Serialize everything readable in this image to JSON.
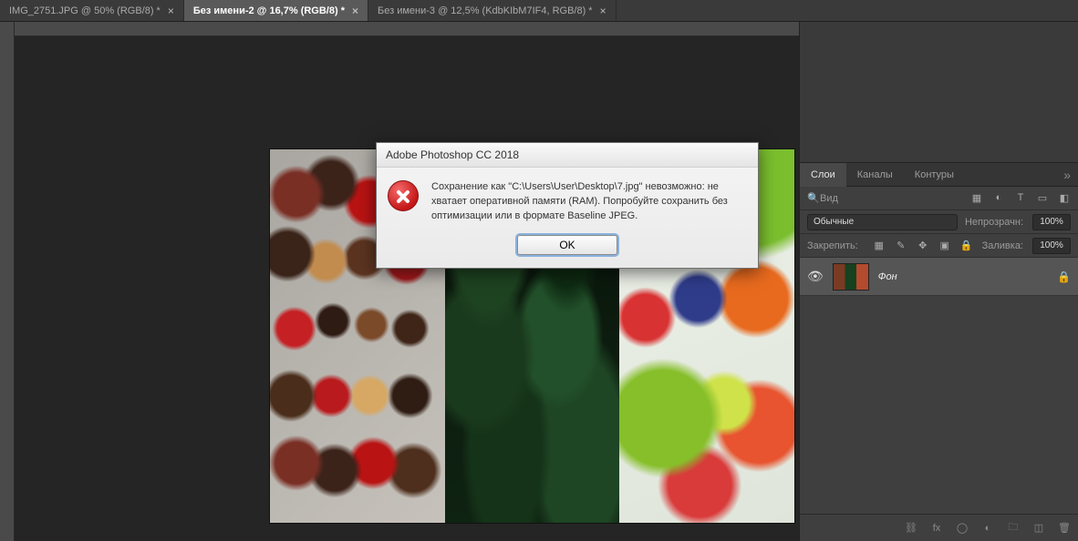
{
  "tabs": [
    {
      "label": "IMG_2751.JPG @ 50% (RGB/8) *",
      "active": false
    },
    {
      "label": "Без имени-2 @ 16,7% (RGB/8) *",
      "active": true
    },
    {
      "label": "Без имени-3 @ 12,5% (KdbKIbM7IF4, RGB/8) *",
      "active": false
    }
  ],
  "dialog": {
    "title": "Adobe Photoshop CC 2018",
    "message": "Сохранение как \"C:\\Users\\User\\Desktop\\7.jpg\" невозможно: не хватает оперативной памяти (RAM). Попробуйте сохранить без оптимизации или в формате Baseline JPEG.",
    "ok": "OK"
  },
  "layers_panel": {
    "tabs": {
      "layers": "Слои",
      "channels": "Каналы",
      "paths": "Контуры"
    },
    "kind_label": "Вид",
    "blend_mode": "Обычные",
    "opacity_label": "Непрозрачн:",
    "opacity_value": "100%",
    "lock_label": "Закрепить:",
    "fill_label": "Заливка:",
    "fill_value": "100%",
    "layer_name": "Фон",
    "footer_link": "fx"
  }
}
